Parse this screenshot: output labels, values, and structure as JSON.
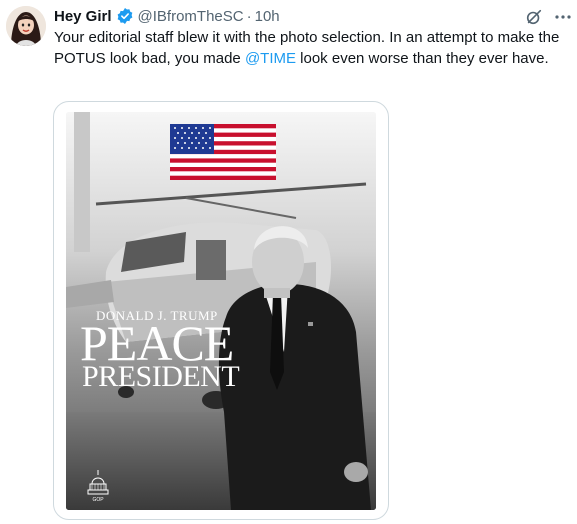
{
  "tweet": {
    "display_name": "Hey Girl",
    "handle": "@IBfromTheSC",
    "separator": "·",
    "time": "10h",
    "text_before": "Your editorial staff blew it with the photo selection. In an attempt to make the POTUS look bad, you made ",
    "mention": "@TIME",
    "text_after": " look even worse than they ever have."
  },
  "media": {
    "cover_name": "DONALD J. TRUMP",
    "cover_title": "PEACE",
    "cover_subtitle": "PRESIDENT",
    "logo_text": "GOP"
  },
  "icons": {
    "verified": "verified-badge-icon",
    "grok": "grok-icon",
    "more": "more-options-icon"
  },
  "colors": {
    "verified_blue": "#1d9bf0",
    "link_blue": "#1d9bf0",
    "text": "#0f1419",
    "secondary_text": "#536471"
  }
}
